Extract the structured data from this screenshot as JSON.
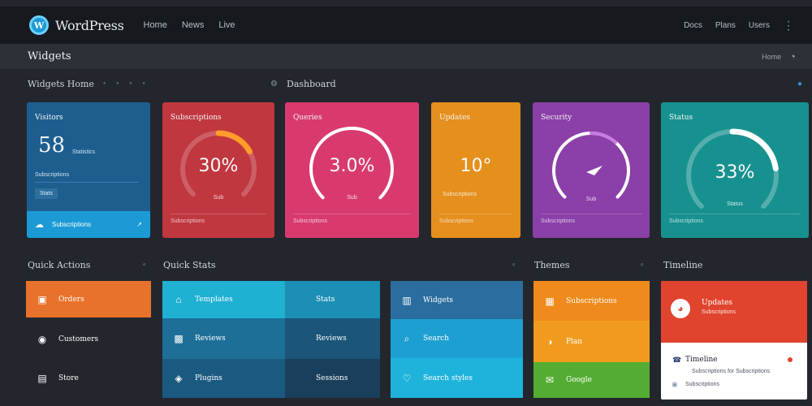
{
  "topbar": {
    "brand": "WordPress",
    "nav": [
      "Home",
      "News",
      "Live"
    ],
    "right": [
      "Docs",
      "Plans",
      "Users"
    ]
  },
  "page": {
    "title": "Widgets",
    "action": "Home"
  },
  "sections": {
    "top_left": "Widgets Home",
    "top_right": "Dashboard",
    "bottom_1": "Quick Actions",
    "bottom_2": "Quick Stats",
    "bottom_3": "Themes",
    "bottom_4": "Timeline"
  },
  "cards": [
    {
      "title": "Visitors",
      "big": "58",
      "sub": "Statistics",
      "line": "Subscriptions",
      "chip": "Stats",
      "footer": "Subscriptions",
      "color": "#1e5e8f",
      "footer_color": "#1b9ad6"
    },
    {
      "title": "Subscriptions",
      "value": "30%",
      "sub": "Sub",
      "footer": "Subscriptions",
      "color": "#c0373f",
      "level": 0.45
    },
    {
      "title": "Queries",
      "value": "3.0%",
      "sub": "Sub",
      "footer": "Subscriptions",
      "color": "#d83a6e",
      "level": 0.55
    },
    {
      "title": "Updates",
      "value": "10°",
      "sub": "Subscriptions",
      "footer": "Subscriptions",
      "color": "#e58f1d",
      "level": 0
    },
    {
      "title": "Security",
      "value": "",
      "sub": "Sub",
      "footer": "Subscriptions",
      "color": "#8b3fa8",
      "level": 0.3
    },
    {
      "title": "Status",
      "value": "33%",
      "sub": "Status",
      "footer": "Subscriptions",
      "color": "#17918f",
      "level": 0.6
    }
  ],
  "quick_actions": [
    "Orders",
    "Customers",
    "Store"
  ],
  "quick_stats": [
    [
      "Templates",
      "Stats"
    ],
    [
      "Reviews",
      "Reviews"
    ],
    [
      "Plugins",
      "Sessions"
    ]
  ],
  "stats3": [
    "Widgets",
    "Search",
    "Search styles"
  ],
  "themes": [
    "Subscriptions",
    "Plan",
    "Google"
  ],
  "timeline": {
    "head": "Updates",
    "head_sub": "Subscriptions",
    "item": "Timeline",
    "line1": "Subscriptions for Subscriptions",
    "line2": "Subscriptions"
  }
}
